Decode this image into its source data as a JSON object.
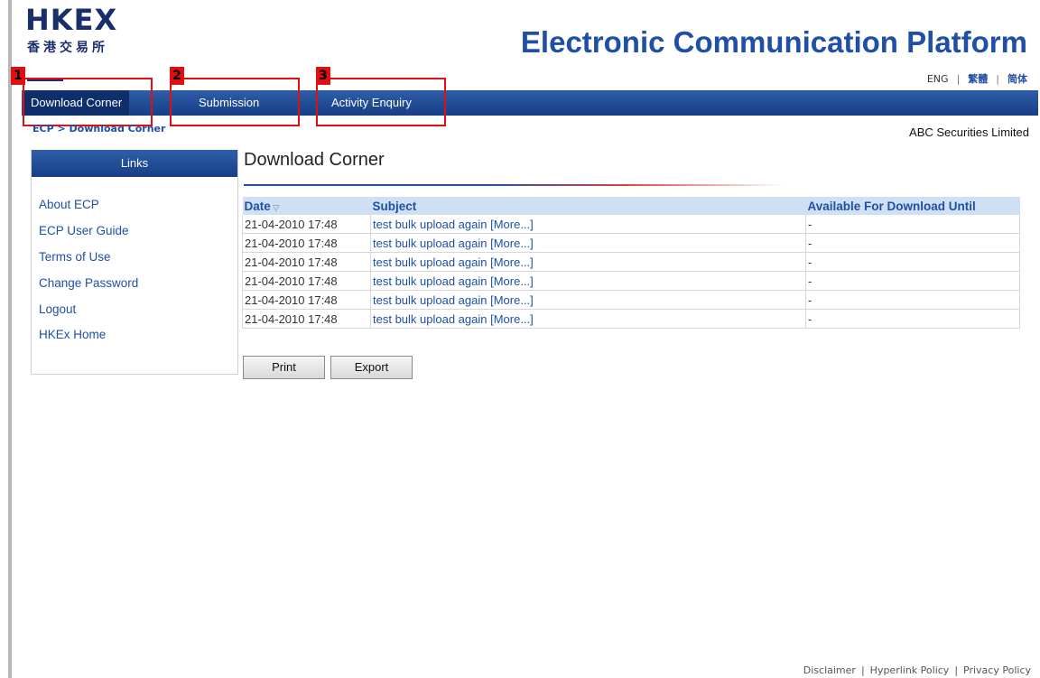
{
  "brand": {
    "logo_en": "HKEX",
    "logo_zh": "香港交易所",
    "platform_title": "Electronic Communication Platform"
  },
  "languages": [
    "ENG",
    "繁體",
    "简体"
  ],
  "nav": {
    "items": [
      {
        "label": "Download Corner",
        "callout": "1"
      },
      {
        "label": "Submission",
        "callout": "2"
      },
      {
        "label": "Activity Enquiry",
        "callout": "3"
      }
    ],
    "accent": "#1f4fa6",
    "callout_color": "#e01010"
  },
  "breadcrumb": "ECP > Download Corner",
  "company": "ABC Securities Limited",
  "sidebar": {
    "header": "Links",
    "items": [
      "About ECP",
      "ECP User Guide",
      "Terms of Use",
      "Change Password",
      "Logout",
      "HKEx Home"
    ]
  },
  "main": {
    "title": "Download Corner",
    "table": {
      "headers": [
        "Date",
        "Subject",
        "Available For Download Until"
      ],
      "rows": [
        {
          "date": "21-04-2010 17:48",
          "subject": "test bulk upload again [More...]",
          "until": "-"
        },
        {
          "date": "21-04-2010 17:48",
          "subject": "test bulk upload again [More...]",
          "until": "-"
        },
        {
          "date": "21-04-2010 17:48",
          "subject": "test bulk upload again [More...]",
          "until": "-"
        },
        {
          "date": "21-04-2010 17:48",
          "subject": "test bulk upload again [More...]",
          "until": "-"
        },
        {
          "date": "21-04-2010 17:48",
          "subject": "test bulk upload again [More...]",
          "until": "-"
        },
        {
          "date": "21-04-2010 17:48",
          "subject": "test bulk upload again [More...]",
          "until": "-"
        }
      ]
    },
    "buttons": {
      "print": "Print",
      "export": "Export"
    }
  },
  "footer": [
    "Disclaimer",
    "Hyperlink Policy",
    "Privacy Policy"
  ]
}
